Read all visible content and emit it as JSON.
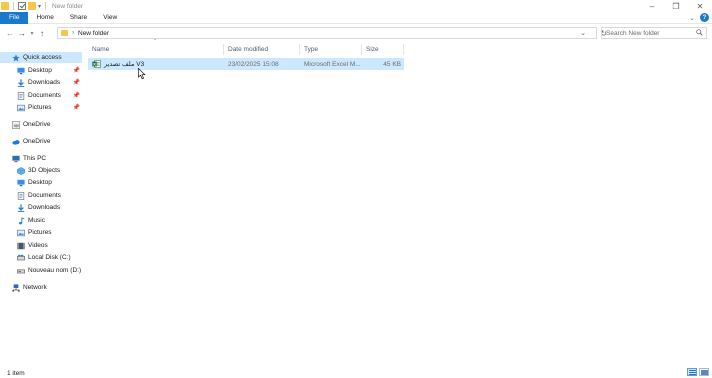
{
  "window": {
    "title": "New folder"
  },
  "ribbon": {
    "tabs": [
      "File",
      "Home",
      "Share",
      "View"
    ]
  },
  "address": {
    "path": "New folder"
  },
  "search": {
    "placeholder": "Search New folder"
  },
  "sidebar": {
    "items": [
      {
        "label": "Quick access",
        "icon": "star-icon",
        "pinned": false
      },
      {
        "label": "Desktop",
        "icon": "desktop-icon",
        "pinned": true
      },
      {
        "label": "Downloads",
        "icon": "download-icon",
        "pinned": true
      },
      {
        "label": "Documents",
        "icon": "documents-icon",
        "pinned": true
      },
      {
        "label": "Pictures",
        "icon": "pictures-icon",
        "pinned": true
      },
      {
        "label": "OneDrive",
        "icon": "onedrive-icon"
      },
      {
        "label": "OneDrive",
        "icon": "onedrive-icon"
      },
      {
        "label": "This PC",
        "icon": "pc-icon"
      },
      {
        "label": "3D Objects",
        "icon": "cube-icon"
      },
      {
        "label": "Desktop",
        "icon": "desktop-icon"
      },
      {
        "label": "Documents",
        "icon": "documents-icon"
      },
      {
        "label": "Downloads",
        "icon": "download-icon"
      },
      {
        "label": "Music",
        "icon": "music-icon"
      },
      {
        "label": "Pictures",
        "icon": "pictures-icon"
      },
      {
        "label": "Videos",
        "icon": "videos-icon"
      },
      {
        "label": "Local Disk (C:)",
        "icon": "drive-icon"
      },
      {
        "label": "Nouveau nom (D:)",
        "icon": "drive-icon"
      },
      {
        "label": "Network",
        "icon": "network-icon"
      }
    ]
  },
  "columns": {
    "name": "Name",
    "date": "Date modified",
    "type": "Type",
    "size": "Size"
  },
  "files": [
    {
      "name": "ملف تصدير V3",
      "date": "23/02/2025 15:08",
      "type": "Microsoft Excel M...",
      "size": "45 KB"
    }
  ],
  "status": {
    "count": "1 item"
  },
  "colors": {
    "accent": "#1979ca",
    "selection": "#cce8ff",
    "folder": "#f4c64a",
    "excel": "#1d6f42"
  }
}
